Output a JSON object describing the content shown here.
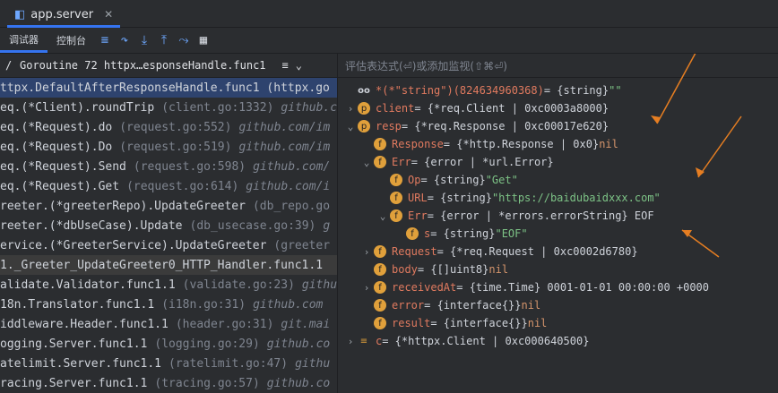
{
  "window": {
    "tab_label": "app.server",
    "tab_close": "✕"
  },
  "toolbar": {
    "tabs": [
      "调试器",
      "控制台"
    ]
  },
  "left": {
    "thread": "Goroutine 72 httpx…esponseHandle.func1",
    "frames": [
      {
        "fn": "ttpx.DefaultAfterResponseHandle.func1 (httpx.go",
        "loc": "",
        "pkg": ""
      },
      {
        "fn": "eq.(*Client).roundTrip",
        "loc": "(client.go:1332)",
        "pkg": "github.c"
      },
      {
        "fn": "eq.(*Request).do",
        "loc": "(request.go:552)",
        "pkg": "github.com/im"
      },
      {
        "fn": "eq.(*Request).Do",
        "loc": "(request.go:519)",
        "pkg": "github.com/im"
      },
      {
        "fn": "eq.(*Request).Send",
        "loc": "(request.go:598)",
        "pkg": "github.com/"
      },
      {
        "fn": "eq.(*Request).Get",
        "loc": "(request.go:614)",
        "pkg": "github.com/i"
      },
      {
        "fn": "reeter.(*greeterRepo).UpdateGreeter",
        "loc": "(db_repo.go",
        "pkg": ""
      },
      {
        "fn": "reeter.(*dbUseCase).Update",
        "loc": "(db_usecase.go:39)",
        "pkg": "g"
      },
      {
        "fn": "ervice.(*GreeterService).UpdateGreeter",
        "loc": "(greeter",
        "pkg": ""
      },
      {
        "fn": "1._Greeter_UpdateGreeter0_HTTP_Handler.func1.1",
        "loc": "",
        "pkg": ""
      },
      {
        "fn": "alidate.Validator.func1.1",
        "loc": "(validate.go:23)",
        "pkg": "githu"
      },
      {
        "fn": "18n.Translator.func1.1",
        "loc": "(i18n.go:31)",
        "pkg": "github.com"
      },
      {
        "fn": "iddleware.Header.func1.1",
        "loc": "(header.go:31)",
        "pkg": "git.mai"
      },
      {
        "fn": "ogging.Server.func1.1",
        "loc": "(logging.go:29)",
        "pkg": "github.co"
      },
      {
        "fn": "atelimit.Server.func1.1",
        "loc": "(ratelimit.go:47)",
        "pkg": "githu"
      },
      {
        "fn": "racing.Server.func1.1",
        "loc": "(tracing.go:57)",
        "pkg": "github.co"
      }
    ]
  },
  "right": {
    "eval_placeholder": "评估表达式(⏎)或添加监视(⇧⌘⏎)",
    "vars": [
      {
        "indent": 0,
        "arrow": "",
        "badge": "oo",
        "name": "*(*\"string\")(824634960368)",
        "rest": " = {string} ",
        "value": "\"\""
      },
      {
        "indent": 0,
        "arrow": "›",
        "badge": "p",
        "name": "client",
        "rest": " = {*req.Client | 0xc0003a8000}",
        "value": ""
      },
      {
        "indent": 0,
        "arrow": "⌄",
        "badge": "p",
        "name": "resp",
        "rest": " = {*req.Response | 0xc00017e620}",
        "value": ""
      },
      {
        "indent": 1,
        "arrow": "",
        "badge": "f",
        "name": "Response",
        "rest": " = {*http.Response | 0x0} ",
        "value": "nil"
      },
      {
        "indent": 1,
        "arrow": "⌄",
        "badge": "f",
        "name": "Err",
        "rest": " = {error | *url.Error}",
        "value": ""
      },
      {
        "indent": 2,
        "arrow": "",
        "badge": "f",
        "name": "Op",
        "rest": " = {string} ",
        "value": "\"Get\""
      },
      {
        "indent": 2,
        "arrow": "",
        "badge": "f",
        "name": "URL",
        "rest": " = {string} ",
        "value": "\"https://baidubaidxxx.com\""
      },
      {
        "indent": 2,
        "arrow": "⌄",
        "badge": "f",
        "name": "Err",
        "rest": " = {error | *errors.errorString} EOF",
        "value": ""
      },
      {
        "indent": 3,
        "arrow": "",
        "badge": "f",
        "name": "s",
        "rest": " = {string} ",
        "value": "\"EOF\""
      },
      {
        "indent": 1,
        "arrow": "›",
        "badge": "f",
        "name": "Request",
        "rest": " = {*req.Request | 0xc0002d6780}",
        "value": ""
      },
      {
        "indent": 1,
        "arrow": "",
        "badge": "f",
        "name": "body",
        "rest": " = {[]uint8} ",
        "value": "nil"
      },
      {
        "indent": 1,
        "arrow": "›",
        "badge": "f",
        "name": "receivedAt",
        "rest": " = {time.Time} 0001-01-01 00:00:00 +0000",
        "value": ""
      },
      {
        "indent": 1,
        "arrow": "",
        "badge": "f",
        "name": "error",
        "rest": " = {interface{}} ",
        "value": "nil"
      },
      {
        "indent": 1,
        "arrow": "",
        "badge": "f",
        "name": "result",
        "rest": " = {interface{}} ",
        "value": "nil"
      },
      {
        "indent": 0,
        "arrow": "›",
        "badge": "≡",
        "name": "c",
        "rest": " = {*httpx.Client | 0xc000640500}",
        "value": ""
      }
    ]
  }
}
